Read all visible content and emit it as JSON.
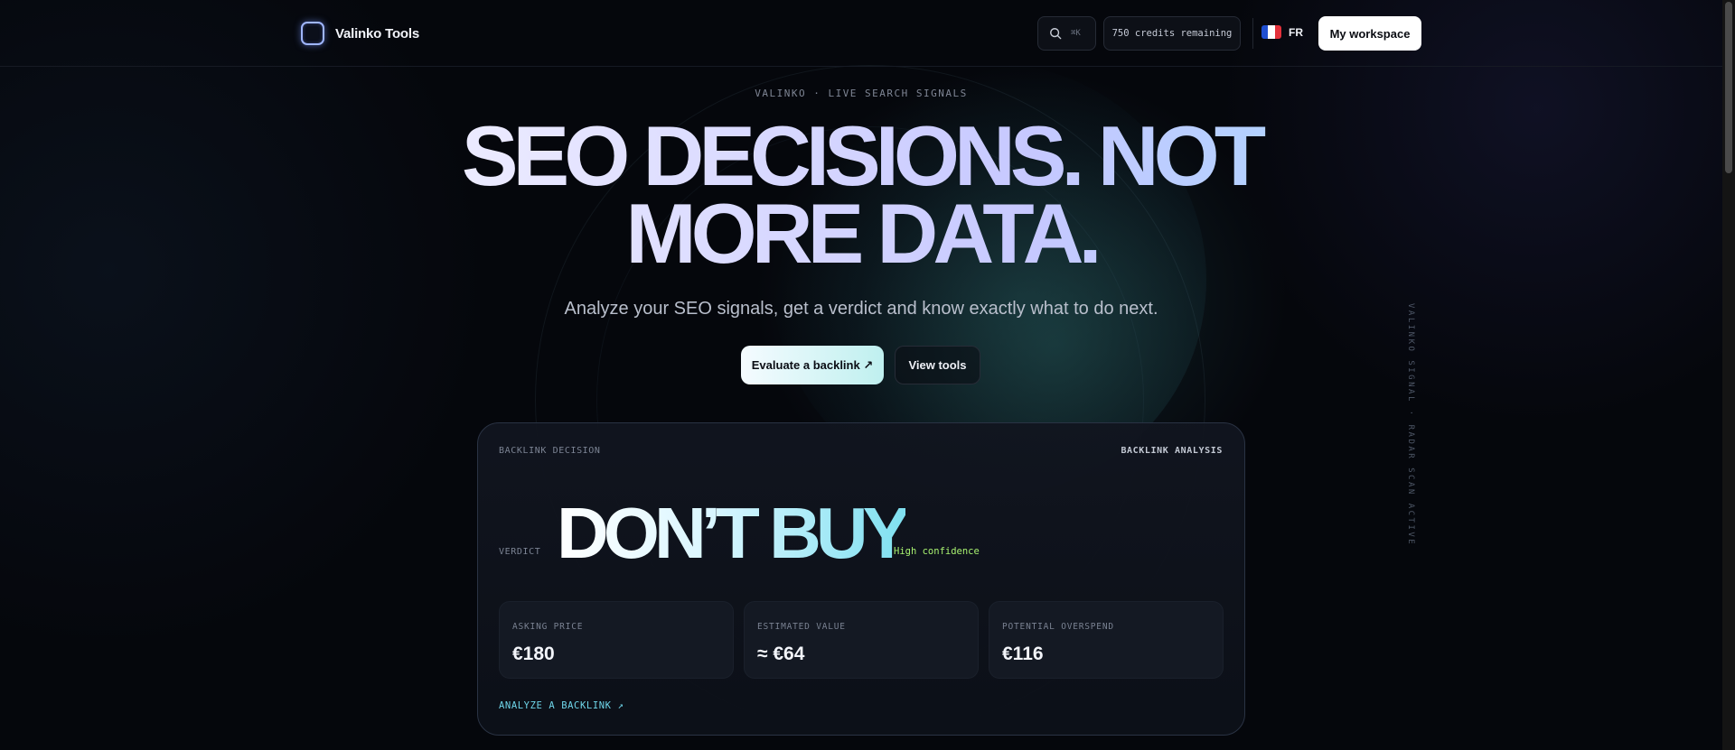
{
  "header": {
    "brand": "Valinko Tools",
    "search_shortcut": "⌘K",
    "credits": "750 credits remaining",
    "language": "FR",
    "workspace_button": "My workspace"
  },
  "hero": {
    "eyebrow": "VALINKO · LIVE SEARCH SIGNALS",
    "headline_line1": "SEO DECISIONS. NOT",
    "headline_line2": "MORE DATA.",
    "subtitle": "Analyze your SEO signals, get a verdict and know exactly what to do next.",
    "cta_primary": "Evaluate a backlink ↗",
    "cta_secondary": "View tools"
  },
  "card": {
    "label": "BACKLINK DECISION",
    "tag": "BACKLINK ANALYSIS",
    "verdict_label": "VERDICT",
    "verdict": "DON’T BUY",
    "confidence": "High confidence",
    "stats": [
      {
        "label": "ASKING PRICE",
        "value": "€180"
      },
      {
        "label": "ESTIMATED VALUE",
        "value": "≈ €64"
      },
      {
        "label": "POTENTIAL OVERSPEND",
        "value": "€116"
      }
    ],
    "link": "ANALYZE A BACKLINK ↗"
  },
  "side_text": "VALINKO SIGNAL · RADAR SCAN ACTIVE",
  "colors": {
    "background": "#05070c",
    "accent_cyan": "#6fd6ea",
    "confidence_green": "#a7f070",
    "flag_blue": "#1f4fd1",
    "flag_white": "#ffffff",
    "flag_red": "#e3313b"
  },
  "icons": {
    "search": "search-icon",
    "logo": "logo-icon",
    "flag": "flag-fr-icon"
  }
}
